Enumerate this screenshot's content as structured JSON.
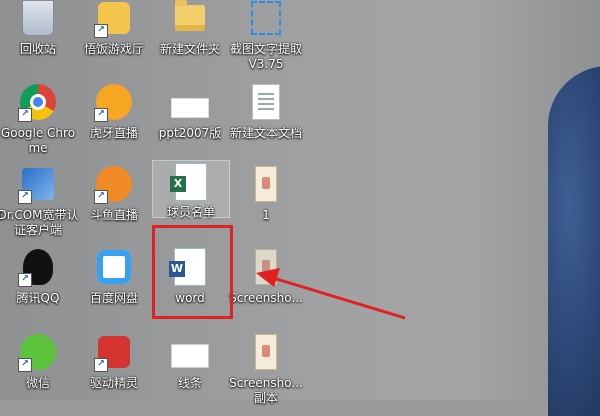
{
  "desktop": {
    "icons": [
      {
        "id": "recycle",
        "label": "回收站",
        "icon": "recycle-bin-icon"
      },
      {
        "id": "game",
        "label": "悟饭游戏厅",
        "icon": "game-hall-icon"
      },
      {
        "id": "folder",
        "label": "新建文件夹",
        "icon": "folder-icon"
      },
      {
        "id": "ocr",
        "label": "截图文字提取 V3.75",
        "icon": "screenshot-text-icon"
      },
      {
        "id": "chrome",
        "label": "Google Chrome",
        "icon": "chrome-icon"
      },
      {
        "id": "huya",
        "label": "虎牙直播",
        "icon": "huya-icon"
      },
      {
        "id": "ppt",
        "label": "ppt2007版",
        "icon": "ppt-file-icon"
      },
      {
        "id": "txt",
        "label": "新建文本文档",
        "icon": "text-document-icon"
      },
      {
        "id": "drcom",
        "label": "Dr.COM宽带认证客户端",
        "icon": "drcom-icon"
      },
      {
        "id": "douyu",
        "label": "斗鱼直播",
        "icon": "douyu-icon"
      },
      {
        "id": "roster",
        "label": "球员名单",
        "icon": "excel-file-icon"
      },
      {
        "id": "img1",
        "label": "1",
        "icon": "image-file-icon"
      },
      {
        "id": "qq",
        "label": "腾讯QQ",
        "icon": "qq-icon"
      },
      {
        "id": "baidu",
        "label": "百度网盘",
        "icon": "baidu-netdisk-icon"
      },
      {
        "id": "word",
        "label": "word",
        "icon": "word-file-icon"
      },
      {
        "id": "shot1",
        "label": "Screensho...",
        "icon": "image-file-icon"
      },
      {
        "id": "wechat",
        "label": "微信",
        "icon": "wechat-icon"
      },
      {
        "id": "driver",
        "label": "驱动精灵",
        "icon": "driver-genius-icon"
      },
      {
        "id": "line",
        "label": "线条",
        "icon": "line-file-icon"
      },
      {
        "id": "shot2",
        "label": "Screensho... 副本",
        "icon": "image-file-icon"
      }
    ]
  },
  "annotation": {
    "highlight_color": "#e12121",
    "arrow_color": "#e12121"
  }
}
